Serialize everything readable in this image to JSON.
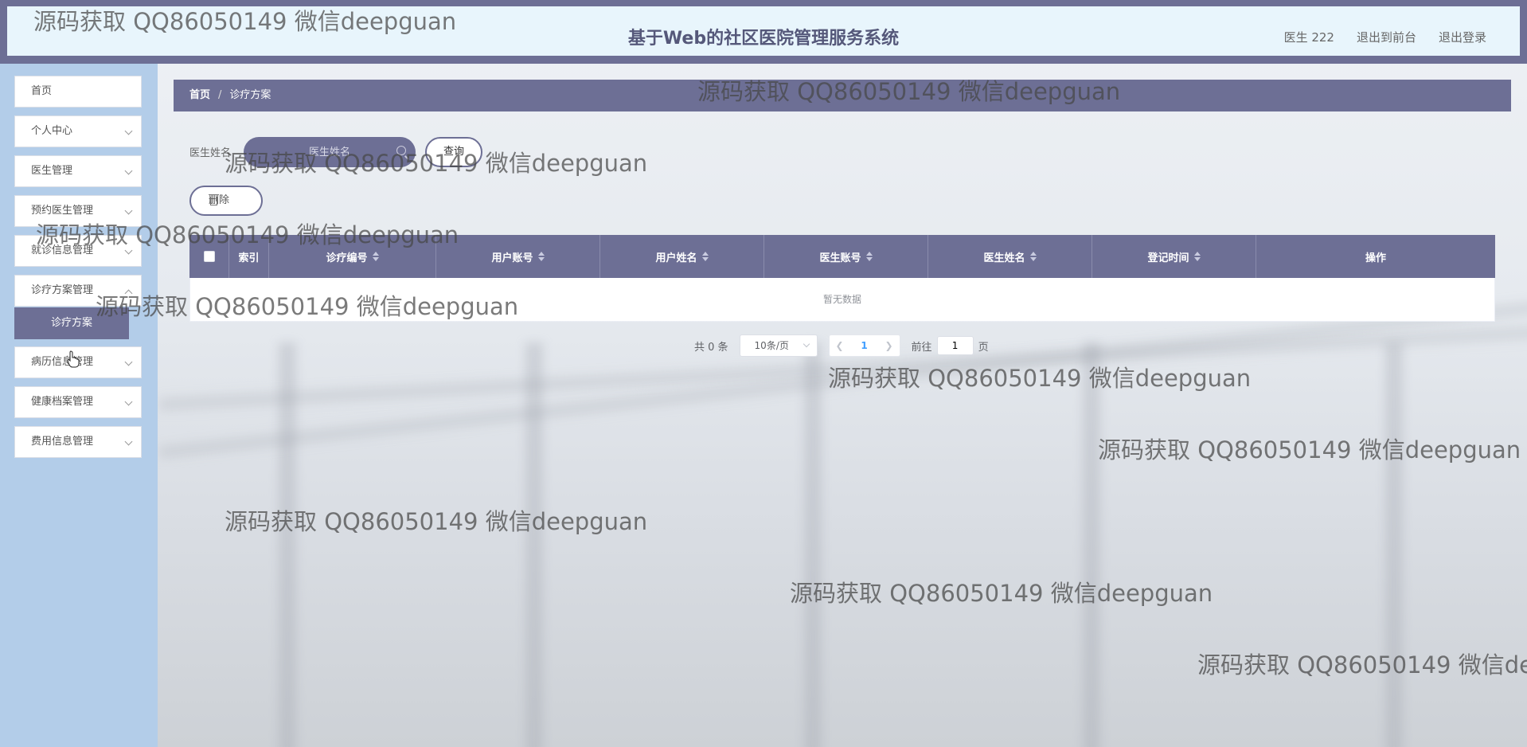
{
  "header": {
    "title": "基于Web的社区医院管理服务系统",
    "user": "医生 222",
    "front_link": "退出到前台",
    "logout_link": "退出登录"
  },
  "sidebar": {
    "items": [
      {
        "label": "首页"
      },
      {
        "label": "个人中心"
      },
      {
        "label": "医生管理"
      },
      {
        "label": "预约医生管理"
      },
      {
        "label": "就诊信息管理"
      },
      {
        "label": "诊疗方案管理"
      },
      {
        "label": "病历信息管理"
      },
      {
        "label": "健康档案管理"
      },
      {
        "label": "费用信息管理"
      }
    ],
    "active_submenu": "诊疗方案"
  },
  "breadcrumb": {
    "home": "首页",
    "separator": "/",
    "current": "诊疗方案"
  },
  "search": {
    "label": "医生姓名",
    "placeholder": "医生姓名",
    "button": "查询"
  },
  "actions": {
    "delete": "删除"
  },
  "table": {
    "columns": [
      "索引",
      "诊疗编号",
      "用户账号",
      "用户姓名",
      "医生账号",
      "医生姓名",
      "登记时间",
      "操作"
    ],
    "empty_text": "暂无数据"
  },
  "pagination": {
    "total": "共 0 条",
    "page_size": "10条/页",
    "current_page": "1",
    "goto_prefix": "前往",
    "goto_value": "1",
    "goto_suffix": "页"
  },
  "watermark": "源码获取 QQ86050149 微信deepguan",
  "colors": {
    "primary": "#6d6f95",
    "sidebar_bg": "#b3cde9",
    "header_bg": "#e8f5fc"
  }
}
